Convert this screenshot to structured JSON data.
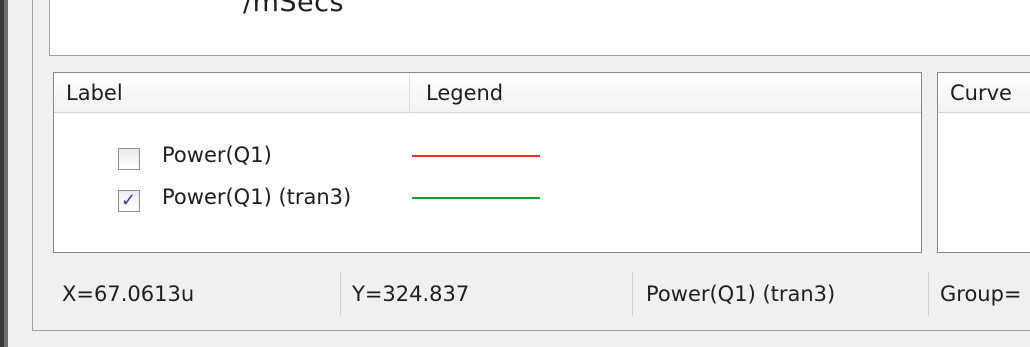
{
  "top_box": {
    "unit_text": "/mSecs"
  },
  "legend_table": {
    "columns": [
      "Label",
      "Legend"
    ],
    "rows": [
      {
        "label": "Power(Q1)",
        "checked": false,
        "line_color": "#ff2a2a"
      },
      {
        "label": "Power(Q1) (tran3)",
        "checked": true,
        "line_color": "#1c9a2c"
      }
    ]
  },
  "curve_panel": {
    "header": "Curve"
  },
  "status_bar": {
    "x": "X=67.0613u",
    "y": "Y=324.837",
    "trace": "Power(Q1) (tran3)",
    "group": "Group="
  }
}
